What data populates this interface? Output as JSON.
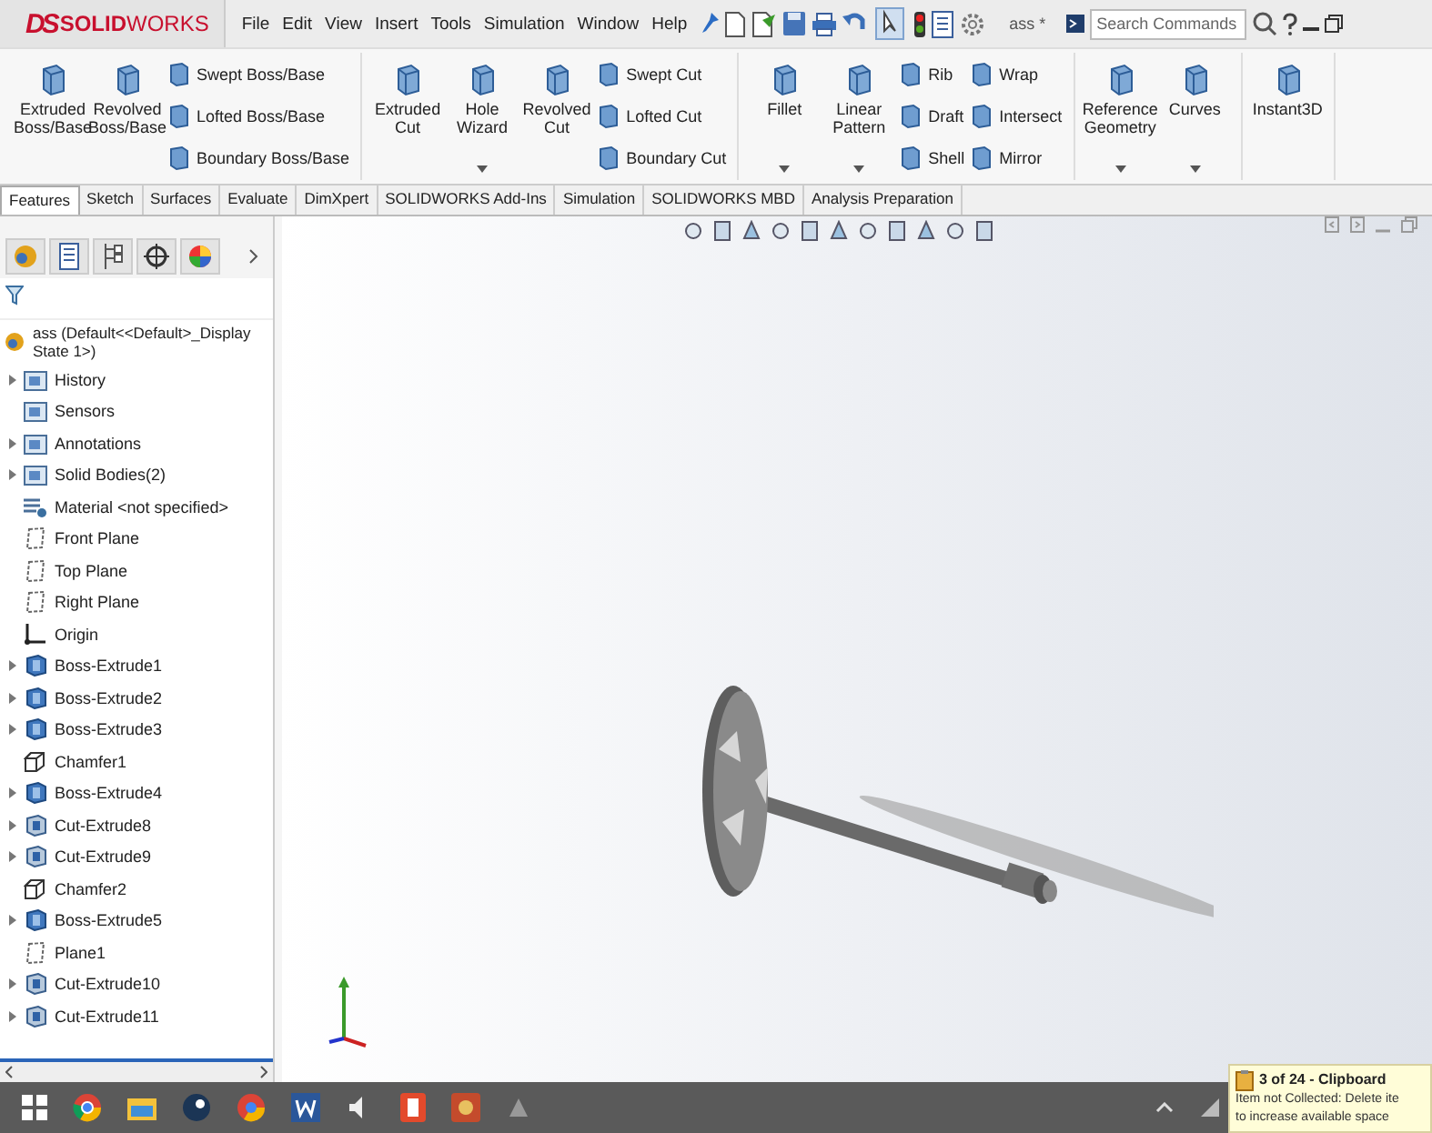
{
  "app": {
    "logo_mark": "DS",
    "logo": "**SOLID**WORKS",
    "menu": [
      "File",
      "Edit",
      "View",
      "Insert",
      "Tools",
      "Simulation",
      "Window",
      "Help"
    ],
    "document_title": "ass *",
    "search": {
      "placeholder": "Search Commands"
    }
  },
  "ribbon": [
    {
      "columns": [
        {
          "kind": "big",
          "label": "Extruded Boss/Base",
          "dropdown": false
        },
        {
          "kind": "big",
          "label": "Revolved Boss/Base",
          "dropdown": false
        },
        {
          "kind": "stack",
          "items": [
            "Swept Boss/Base",
            "Lofted Boss/Base",
            "Boundary Boss/Base"
          ]
        }
      ]
    },
    {
      "columns": [
        {
          "kind": "big",
          "label": "Extruded Cut",
          "dropdown": false
        },
        {
          "kind": "big",
          "label": "Hole Wizard",
          "dropdown": true
        },
        {
          "kind": "big",
          "label": "Revolved Cut",
          "dropdown": false
        },
        {
          "kind": "stack",
          "items": [
            "Swept Cut",
            "Lofted Cut",
            "Boundary Cut"
          ]
        }
      ]
    },
    {
      "columns": [
        {
          "kind": "big",
          "label": "Fillet",
          "dropdown": true
        },
        {
          "kind": "big",
          "label": "Linear Pattern",
          "dropdown": true
        },
        {
          "kind": "stack",
          "items": [
            "Rib",
            "Draft",
            "Shell"
          ]
        },
        {
          "kind": "stack",
          "items": [
            "Wrap",
            "Intersect",
            "Mirror"
          ]
        }
      ]
    },
    {
      "columns": [
        {
          "kind": "big",
          "label": "Reference Geometry",
          "dropdown": true
        },
        {
          "kind": "big",
          "label": "Curves",
          "dropdown": true
        }
      ]
    },
    {
      "columns": [
        {
          "kind": "big",
          "label": "Instant3D",
          "dropdown": false
        }
      ]
    }
  ],
  "tabs": [
    {
      "label": "Features",
      "selected": true
    },
    {
      "label": "Sketch",
      "selected": false
    },
    {
      "label": "Surfaces",
      "selected": false
    },
    {
      "label": "Evaluate",
      "selected": false
    },
    {
      "label": "DimXpert",
      "selected": false
    },
    {
      "label": "SOLIDWORKS Add-Ins",
      "selected": false
    },
    {
      "label": "Simulation",
      "selected": false
    },
    {
      "label": "SOLIDWORKS MBD",
      "selected": false
    },
    {
      "label": "Analysis Preparation",
      "selected": false
    }
  ],
  "feature_tree": {
    "root": "ass  (Default<<Default>_Display State 1>)",
    "items": [
      {
        "label": "History",
        "kind": "folder",
        "has_children": true
      },
      {
        "label": "Sensors",
        "kind": "folder",
        "has_children": false
      },
      {
        "label": "Annotations",
        "kind": "folder",
        "has_children": true
      },
      {
        "label": "Solid Bodies(2)",
        "kind": "folder",
        "has_children": true
      },
      {
        "label": "Material <not specified>",
        "kind": "material",
        "has_children": false
      },
      {
        "label": "Front Plane",
        "kind": "plane",
        "has_children": false
      },
      {
        "label": "Top Plane",
        "kind": "plane",
        "has_children": false
      },
      {
        "label": "Right Plane",
        "kind": "plane",
        "has_children": false
      },
      {
        "label": "Origin",
        "kind": "origin",
        "has_children": false
      },
      {
        "label": "Boss-Extrude1",
        "kind": "boss",
        "has_children": true
      },
      {
        "label": "Boss-Extrude2",
        "kind": "boss",
        "has_children": true
      },
      {
        "label": "Boss-Extrude3",
        "kind": "boss",
        "has_children": true
      },
      {
        "label": "Chamfer1",
        "kind": "chamfer",
        "has_children": false
      },
      {
        "label": "Boss-Extrude4",
        "kind": "boss",
        "has_children": true
      },
      {
        "label": "Cut-Extrude8",
        "kind": "cut",
        "has_children": true
      },
      {
        "label": "Cut-Extrude9",
        "kind": "cut",
        "has_children": true
      },
      {
        "label": "Chamfer2",
        "kind": "chamfer",
        "has_children": false
      },
      {
        "label": "Boss-Extrude5",
        "kind": "boss",
        "has_children": true
      },
      {
        "label": "Plane1",
        "kind": "plane",
        "has_children": false
      },
      {
        "label": "Cut-Extrude10",
        "kind": "cut",
        "has_children": true
      },
      {
        "label": "Cut-Extrude11",
        "kind": "cut",
        "has_children": true
      }
    ]
  },
  "notification": {
    "title": "3 of 24 - Clipboard",
    "lines": [
      "Item not Collected: Delete ite",
      "to increase available space"
    ]
  }
}
